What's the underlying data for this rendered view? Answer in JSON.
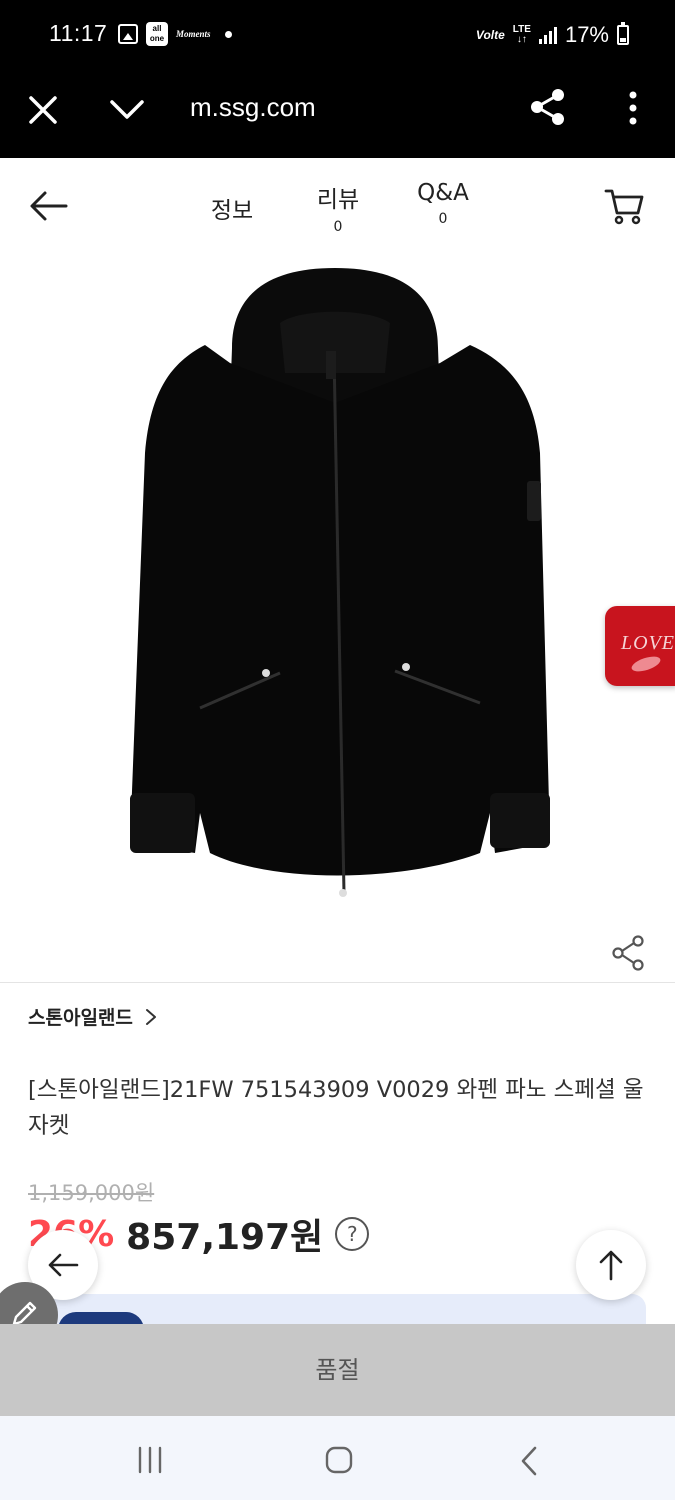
{
  "status_bar": {
    "time": "11:17",
    "allone_label": "all\none",
    "msg_label": "Moments",
    "volte": "Volte",
    "lte": "LTE",
    "battery": "17%"
  },
  "browser": {
    "url": "m.ssg.com",
    "icons": [
      "close-icon",
      "chevron-down-icon",
      "share-icon",
      "more-vert-icon"
    ]
  },
  "header": {
    "tabs": [
      {
        "label": "정보",
        "count": ""
      },
      {
        "label": "리뷰",
        "count": "0"
      },
      {
        "label": "Q&A",
        "count": "0"
      }
    ],
    "icons": [
      "back-arrow-icon",
      "cart-icon"
    ]
  },
  "product": {
    "image_alt": "black hooded zip-up jacket",
    "love_badge": "LOVE",
    "brand": "스톤아일랜드",
    "title": "[스톤아일랜드]21FW 751543909 V0029 와펜 파노 스페셜 울 자켓",
    "original_price": "1,159,000원",
    "discount": "26%",
    "sale_price": "857,197원",
    "help": "?"
  },
  "soldout": {
    "label": "품절"
  },
  "colors": {
    "discount": "#ff4950",
    "soldout_bg": "#c7c7c7",
    "banner_bg": "#e6ecfa",
    "love_badge": "#c8141e"
  }
}
